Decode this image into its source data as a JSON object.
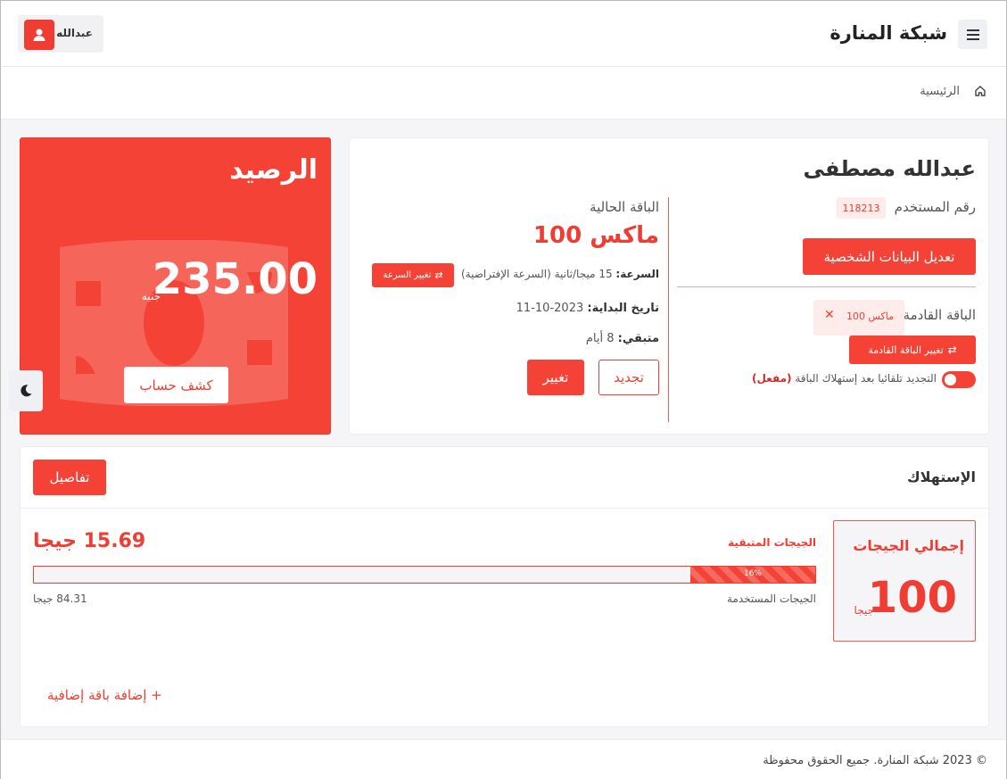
{
  "header": {
    "brand": "شبكة المنارة",
    "user_name": "عبدالله",
    "menu_icon": "hamburger-icon",
    "avatar_icon": "user-icon"
  },
  "breadcrumb": {
    "home": "الرئيسية",
    "icon": "home-icon"
  },
  "profile": {
    "name": "عبدالله مصطفى",
    "user_id_label": "رقم المستخدم",
    "user_id": "118213",
    "edit_button": "تعديل البيانات الشخصية",
    "next_package_label": "الباقة القادمة",
    "next_package_name": "ماكس 100",
    "next_package_remove": "✕",
    "change_next_button": "تغيير الباقة القادمة",
    "auto_renew_enabled": true,
    "auto_renew_text": "التجديد تلقائيا بعد إستهلاك الباقة",
    "auto_renew_status": "(مفعل)"
  },
  "current_package": {
    "title": "الباقة الحالية",
    "name": "ماكس 100",
    "speed_label": "السرعة:",
    "speed_value": "15 ميجا/ثانية (السرعة الإفتراضية)",
    "change_speed_button": "تغيير السرعة",
    "start_label": "تاريخ البداية:",
    "start_value": "2023-10-11",
    "remaining_label": "متبقي:",
    "remaining_value": "8 أيام",
    "renew_button": "تجديد",
    "change_button": "تغيير"
  },
  "balance": {
    "title": "الرصيد",
    "amount": "235.00",
    "currency": "جنيه",
    "statement_button": "كشف حساب",
    "bg_icon": "money-icon"
  },
  "theme": {
    "icon": "moon-icon"
  },
  "usage": {
    "title": "الإستهلاك",
    "details_button": "تفاصيل",
    "total_title": "إجمالي الجيجات",
    "total_value": "100",
    "total_unit": "جيجا",
    "remaining_label": "الجيجات المتبقية",
    "remaining_value": "15.69 جيجا",
    "progress_percent": 16,
    "progress_text": "16%",
    "used_label": "الجيجات المستخدمة",
    "used_value": "84.31 جيجا",
    "add_package": "+ إضافة باقة إضافية"
  },
  "footer": {
    "copyright": "© 2023 شبكة المنارة. جميع الحقوق محفوظة"
  },
  "colors": {
    "accent": "#f44336",
    "accent_dark": "#ef3d33",
    "badge_bg": "#fdecea"
  }
}
